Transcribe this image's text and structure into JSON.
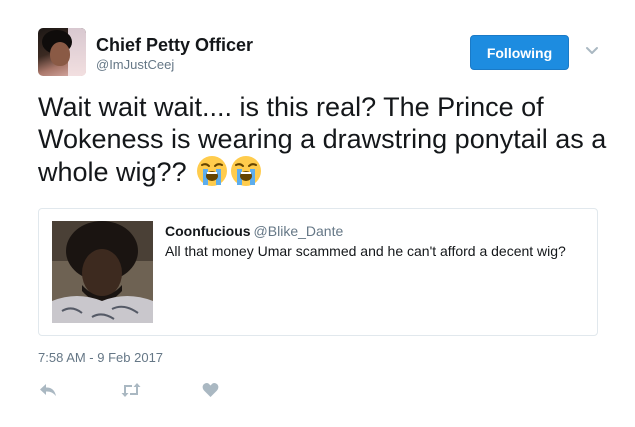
{
  "author": {
    "display_name": "Chief Petty Officer",
    "screen_name": "@ImJustCeej"
  },
  "follow_button": {
    "label": "Following",
    "color": "#1d8ce0"
  },
  "tweet": {
    "text": "Wait wait wait.... is this real? The Prince of Wokeness is wearing a drawstring ponytail as a whole wig??",
    "emoji": [
      "loudly-crying-face",
      "loudly-crying-face"
    ]
  },
  "quoted_tweet": {
    "display_name": "Coonfucious",
    "screen_name": "@Blike_Dante",
    "text": "All that money Umar scammed and he can't afford a decent wig?"
  },
  "timestamp": "7:58 AM - 9 Feb 2017",
  "actions": [
    "reply-icon",
    "retweet-icon",
    "like-icon"
  ]
}
